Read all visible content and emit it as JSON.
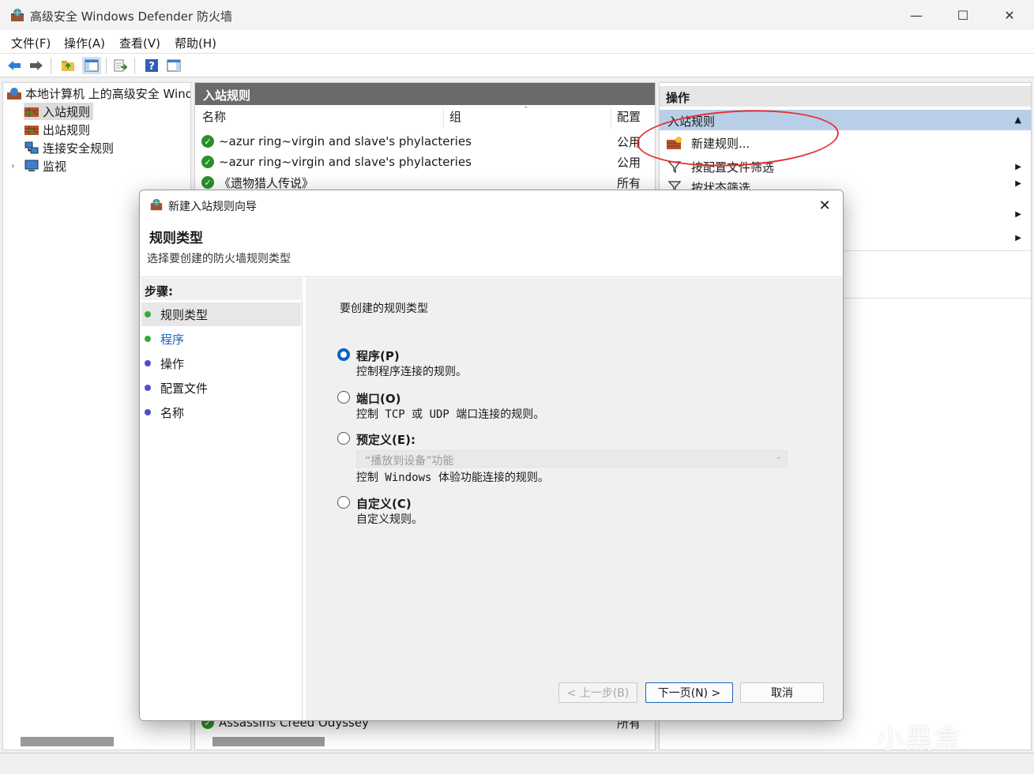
{
  "window": {
    "title": "高级安全 Windows Defender 防火墙",
    "minimize": "—",
    "maximize": "☐",
    "close": "✕"
  },
  "menu": [
    "文件(F)",
    "操作(A)",
    "查看(V)",
    "帮助(H)"
  ],
  "tree": {
    "root": "本地计算机 上的高级安全 Windows Defender 防火墙",
    "items": [
      "入站规则",
      "出站规则",
      "连接安全规则",
      "监视"
    ],
    "expander": "›"
  },
  "center": {
    "header": "入站规则",
    "columns": [
      "名称",
      "组",
      "配置"
    ],
    "sort_indicator": "˄",
    "rows": [
      {
        "name": "~azur ring~virgin and slave's phylacteries",
        "profile": "公用"
      },
      {
        "name": "~azur ring~virgin and slave's phylacteries",
        "profile": "公用"
      },
      {
        "name": "《遗物猎人传说》",
        "profile": "所有"
      },
      {
        "name": "Assassins Creed Odyssey",
        "profile": "所有"
      }
    ]
  },
  "actions": {
    "header": "操作",
    "section": "入站规则",
    "collapse": "▲",
    "items": [
      "新建规则...",
      "按配置文件筛选",
      "按状态筛选",
      "",
      ""
    ],
    "arrow": "▶"
  },
  "dialog": {
    "title": "新建入站规则向导",
    "close": "✕",
    "heading": "规则类型",
    "subheading": "选择要创建的防火墙规则类型",
    "steps_label": "步骤:",
    "steps": [
      "规则类型",
      "程序",
      "操作",
      "配置文件",
      "名称"
    ],
    "prompt": "要创建的规则类型",
    "options": [
      {
        "label": "程序(P)",
        "desc": "控制程序连接的规则。",
        "selected": true
      },
      {
        "label": "端口(O)",
        "desc": "控制 TCP 或 UDP 端口连接的规则。",
        "selected": false
      },
      {
        "label": "预定义(E):",
        "desc": "控制 Windows 体验功能连接的规则。",
        "selected": false
      },
      {
        "label": "自定义(C)",
        "desc": "自定义规则。",
        "selected": false
      }
    ],
    "predefined_select": "“播放到设备”功能",
    "select_chevron": "⌄",
    "buttons": {
      "back": "< 上一步(B)",
      "next": "下一页(N) >",
      "cancel": "取消"
    }
  },
  "watermark": "小黑盒",
  "colors": {
    "accent": "#0b62c4",
    "annotation": "#e53030",
    "section_bg": "#b9cfe8"
  }
}
